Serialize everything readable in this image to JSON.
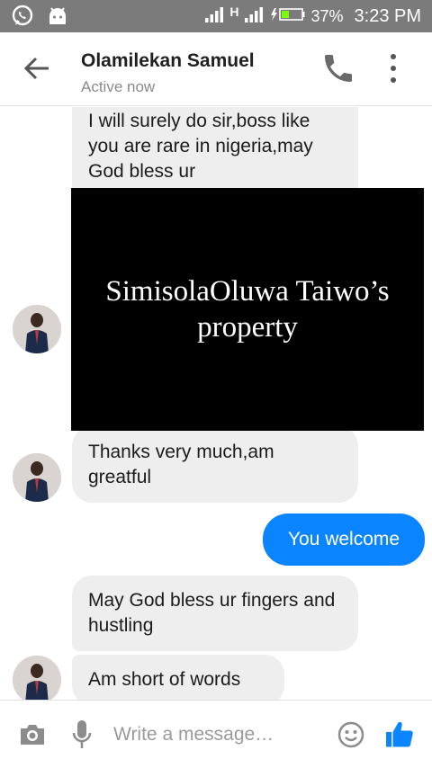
{
  "status_bar": {
    "network": "H",
    "battery": "37%",
    "time": "3:23 PM",
    "icons": [
      "whatsapp-icon",
      "android-icon",
      "signal-icon",
      "network-h-icon",
      "signal-icon",
      "battery-charging-icon"
    ]
  },
  "header": {
    "contact_name": "Olamilekan Samuel",
    "presence": "Active now",
    "icons": [
      "back-arrow-icon",
      "phone-icon",
      "more-vertical-icon"
    ]
  },
  "messages": [
    {
      "direction": "incoming",
      "text": "I will surely do sir,boss like you are rare in nigeria,may God bless ur"
    },
    {
      "direction": "incoming",
      "text": "Thanks very much,am greatful"
    },
    {
      "direction": "outgoing",
      "text": "You welcome"
    },
    {
      "direction": "incoming",
      "text": "May God bless ur fingers and hustling"
    },
    {
      "direction": "incoming",
      "text": "Am short of words"
    }
  ],
  "overlay": {
    "text": "SimisolaOluwa Taiwo’s property"
  },
  "composer": {
    "placeholder": "Write a message…",
    "icons": [
      "camera-icon",
      "mic-icon",
      "emoji-icon",
      "thumbs-up-icon"
    ]
  },
  "colors": {
    "status_bar": "#7b7b7b",
    "incoming_bubble": "#eeeeee",
    "outgoing_bubble": "#0a84ff",
    "accent": "#0a84ff",
    "icon_gray": "#8c8c8c"
  }
}
